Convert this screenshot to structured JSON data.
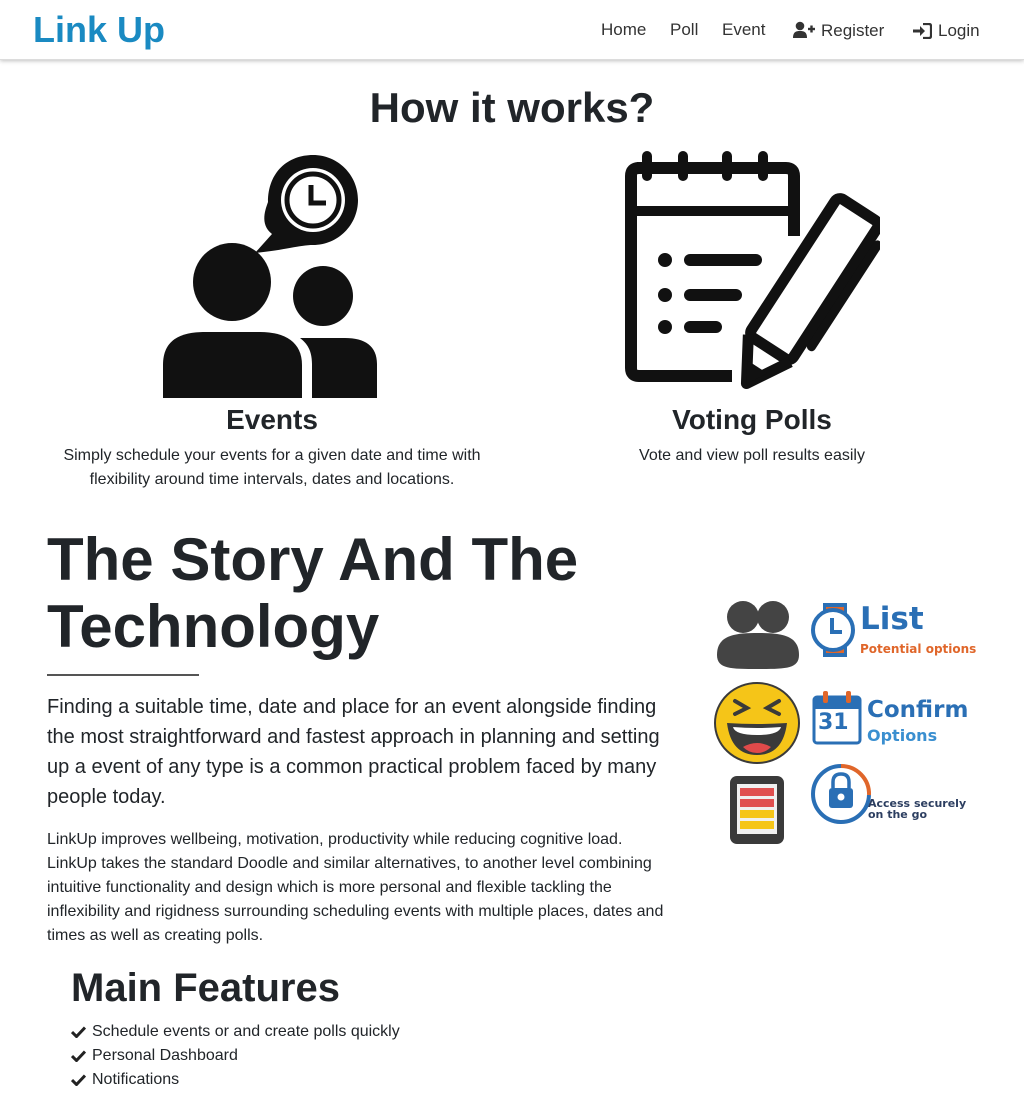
{
  "nav": {
    "brand": "Link Up",
    "items": [
      "Home",
      "Poll",
      "Event"
    ],
    "register": "Register",
    "login": "Login"
  },
  "how_it_works": {
    "title": "How it works?",
    "features": [
      {
        "title": "Events",
        "text": "Simply schedule your events for a given date and time with flexibility around time intervals, dates and locations.",
        "icon": "users-clock-icon"
      },
      {
        "title": "Voting Polls",
        "text": "Vote and view poll results easily",
        "icon": "notepad-pencil-icon"
      }
    ]
  },
  "story": {
    "title": "The Story And The Technology",
    "lead": "Finding a suitable time, date and place for an event alongside finding the most straightforward and fastest approach in planning and setting up a event of any type is a common practical problem faced by many people today.",
    "body": "LinkUp improves wellbeing, motivation, productivity while reducing cognitive load. LinkUp takes the standard Doodle and similar alternatives, to another level combining intuitive functionality and design which is more personal and flexible tackling the inflexibility and rigidness surrounding scheduling events with multiple places, dates and times as well as creating polls."
  },
  "infographic": {
    "list_title": "List",
    "list_sub": "Potential options",
    "confirm_title": "Confirm",
    "confirm_sub": "Options",
    "calendar_day": "31",
    "access_line1": "Access securely",
    "access_line2": "on the go"
  },
  "main_features": {
    "title": "Main Features",
    "items": [
      "Schedule events or and create polls quickly",
      "Personal Dashboard",
      "Notifications"
    ]
  },
  "colors": {
    "brand": "#1a8ac2",
    "info_blue": "#2a6fb5",
    "info_orange": "#e0662a",
    "emoji_yellow": "#f5c518"
  }
}
